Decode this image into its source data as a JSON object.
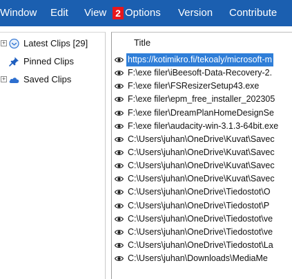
{
  "menubar": {
    "items": [
      "Window",
      "Edit",
      "View",
      "Options",
      "Version",
      "Contribute"
    ],
    "badge": "2",
    "background": "#1b5fb0",
    "badge_color": "#e8171c"
  },
  "tree": {
    "items": [
      {
        "label": "Latest Clips [29]",
        "icon": "clock-icon"
      },
      {
        "label": "Pinned Clips",
        "icon": "pin-icon"
      },
      {
        "label": "Saved Clips",
        "icon": "cloud-icon"
      }
    ]
  },
  "list": {
    "column_title": "Title",
    "selection_color": "#2f7ed8",
    "rows": [
      "https://kotimikro.fi/tekoaly/microsoft-m",
      "F:\\exe filer\\iBeesoft-Data-Recovery-2.",
      "F:\\exe filer\\FSResizerSetup43.exe",
      "F:\\exe filer\\epm_free_installer_202305",
      "F:\\exe filer\\DreamPlanHomeDesignSe",
      "F:\\exe filer\\audacity-win-3.1.3-64bit.exe",
      "C:\\Users\\juhan\\OneDrive\\Kuvat\\Savec",
      "C:\\Users\\juhan\\OneDrive\\Kuvat\\Savec",
      "C:\\Users\\juhan\\OneDrive\\Kuvat\\Savec",
      "C:\\Users\\juhan\\OneDrive\\Kuvat\\Savec",
      "C:\\Users\\juhan\\OneDrive\\Tiedostot\\O",
      "C:\\Users\\juhan\\OneDrive\\Tiedostot\\P",
      "C:\\Users\\juhan\\OneDrive\\Tiedostot\\ve",
      "C:\\Users\\juhan\\OneDrive\\Tiedostot\\ve",
      "C:\\Users\\juhan\\OneDrive\\Tiedostot\\La",
      "C:\\Users\\juhan\\Downloads\\MediaMe"
    ]
  }
}
